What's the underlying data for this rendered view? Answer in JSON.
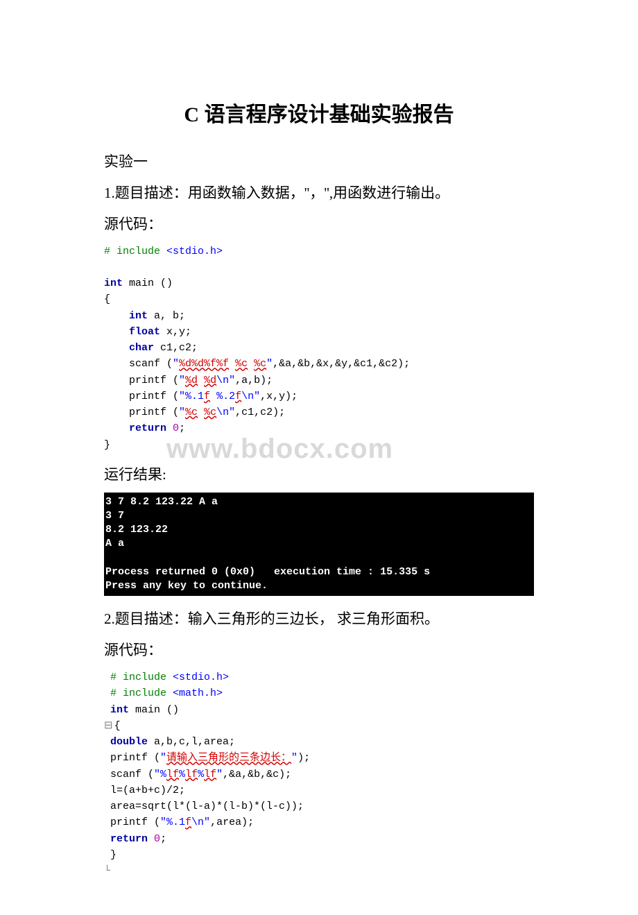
{
  "title": "C 语言程序设计基础实验报告",
  "sec1": {
    "heading": "实验一",
    "q1_desc": "1.题目描述：用函数输入数据，''，'',用函数进行输出。",
    "src_label": "源代码：",
    "code1": {
      "l1a": "# include ",
      "l1b": "<stdio.h>",
      "l2a": "int",
      "l2b": " main ()",
      "l3": "{",
      "l4a": "    ",
      "l4b": "int",
      "l4c": " a, b;",
      "l5a": "    ",
      "l5b": "float",
      "l5c": " x,y;",
      "l6a": "    ",
      "l6b": "char",
      "l6c": " c1,c2;",
      "l7a": "    scanf (",
      "l7b": "\"",
      "l7c": "%d%d%f%f",
      "l7d": " ",
      "l7e": "%c",
      "l7f": " ",
      "l7g": "%c",
      "l7h": "\"",
      "l7i": ",&a,&b,&x,&y,&c1,&c2);",
      "l8a": "    printf (",
      "l8b": "\"",
      "l8c": "%d",
      "l8d": " ",
      "l8e": "%d",
      "l8f": "\\n\"",
      "l8g": ",a,b);",
      "l9a": "    printf (",
      "l9b": "\"%.1",
      "l9c": "f",
      "l9d": " %.2",
      "l9e": "f",
      "l9f": "\\n\"",
      "l9g": ",x,y);",
      "l10a": "    printf (",
      "l10b": "\"",
      "l10c": "%c",
      "l10d": " ",
      "l10e": "%c",
      "l10f": "\\n\"",
      "l10g": ",c1,c2);",
      "l11a": "    ",
      "l11b": "return",
      "l11c": " ",
      "l11d": "0",
      "l11e": ";",
      "l12": "}"
    },
    "result_label": "运行结果:",
    "console1": "3 7 8.2 123.22 A a\n3 7\n8.2 123.22\nA a\n\nProcess returned 0 (0x0)   execution time : 15.335 s\nPress any key to continue.",
    "q2_desc": "2.题目描述：输入三角形的三边长， 求三角形面积。",
    "src_label2": "源代码：",
    "code2": {
      "l1a": " ",
      "l1b": "# include ",
      "l1c": "<stdio.h>",
      "l2a": " ",
      "l2b": "# include ",
      "l2c": "<math.h>",
      "l3a": " ",
      "l3b": "int",
      "l3c": " main ()",
      "l4a": "{",
      "l5a": " ",
      "l5b": "double",
      "l5c": " a,b,c,l,area;",
      "l6a": " printf (",
      "l6b": "\"",
      "l6c": "请输入三角形的三条边长：",
      "l6d": "\"",
      "l6e": ");",
      "l7a": " scanf (",
      "l7b": "\"%",
      "l7c": "lf",
      "l7d": "%",
      "l7e": "lf",
      "l7f": "%",
      "l7g": "lf",
      "l7h": "\"",
      "l7i": ",&a,&b,&c);",
      "l8": " l=(a+b+c)/2;",
      "l9": " area=sqrt(l*(l-a)*(l-b)*(l-c));",
      "l10a": " printf (",
      "l10b": "\"%.1",
      "l10c": "f",
      "l10d": "\\n\"",
      "l10e": ",area);",
      "l11a": " ",
      "l11b": "return",
      "l11c": " ",
      "l11d": "0",
      "l11e": ";",
      "l12": " }"
    }
  },
  "watermark": "www.bdocx.com"
}
